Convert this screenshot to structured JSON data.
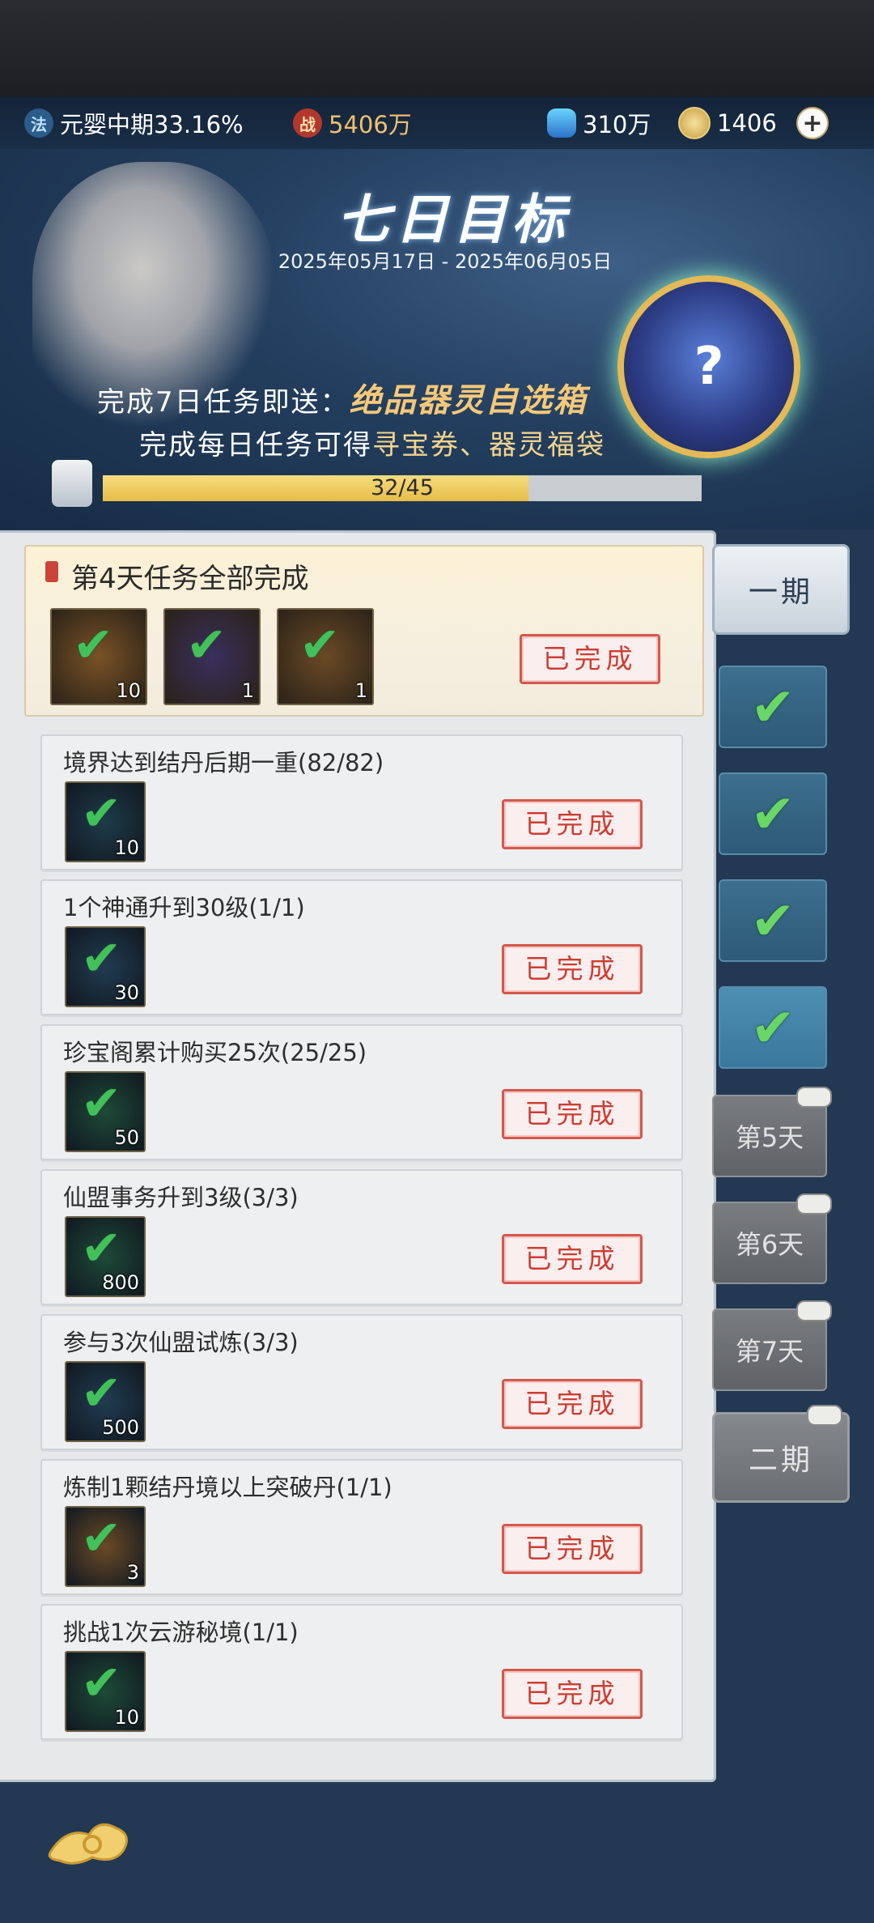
{
  "resources": {
    "realm": {
      "icon": "dao-icon",
      "label": "元婴中期33.16%"
    },
    "power": {
      "icon": "battle-icon",
      "label": "5406万"
    },
    "spirit_stone": {
      "icon": "crystal-icon",
      "label": "310万"
    },
    "jade": {
      "icon": "jade-coin-icon",
      "label": "1406"
    }
  },
  "event": {
    "title": "七日目标",
    "dates": "2025年05月17日 - 2025年06月05日",
    "line1_prefix": "完成7日任务即送：",
    "line1_highlight": "绝品器灵自选箱",
    "line2_prefix": "完成每日任务可得",
    "line2_highlight": "寻宝券、器灵福袋",
    "progress_text": "32/45",
    "progress_fraction": 0.711,
    "mystery_reward_icon": "question-mark-icon"
  },
  "day_summary": {
    "title": "第4天任务全部完成",
    "items": [
      {
        "icon": "talisman-item-icon",
        "count": "10",
        "bg": "#7a5226"
      },
      {
        "icon": "spirit-orb-item-icon",
        "count": "1",
        "bg": "#3a2f5e"
      },
      {
        "icon": "treasure-box-item-icon",
        "count": "1",
        "bg": "#6b4a26"
      }
    ],
    "status": "已完成"
  },
  "tasks": [
    {
      "title": "境界达到结丹后期一重(82/82)",
      "icon": "scroll-item-icon",
      "count": "10",
      "bg": "#1f3b4a",
      "status": "已完成"
    },
    {
      "title": "1个神通升到30级(1/1)",
      "icon": "pouch-item-icon",
      "count": "30",
      "bg": "#223c52",
      "status": "已完成"
    },
    {
      "title": "珍宝阁累计购买25次(25/25)",
      "icon": "chest-item-icon",
      "count": "50",
      "bg": "#1e4a38",
      "status": "已完成"
    },
    {
      "title": "仙盟事务升到3级(3/3)",
      "icon": "bundle-item-icon",
      "count": "800",
      "bg": "#1e4a38",
      "status": "已完成"
    },
    {
      "title": "参与3次仙盟试炼(3/3)",
      "icon": "book-item-icon",
      "count": "500",
      "bg": "#223c52",
      "status": "已完成"
    },
    {
      "title": "炼制1颗结丹境以上突破丹(1/1)",
      "icon": "crystal-item-icon",
      "count": "3",
      "bg": "#6b4a26",
      "status": "已完成"
    },
    {
      "title": "挑战1次云游秘境(1/1)",
      "icon": "jade-item-icon",
      "count": "10",
      "bg": "#1e4a38",
      "status": "已完成"
    }
  ],
  "side_tabs": {
    "period1": "一期",
    "completed_days": [
      "check-icon",
      "check-icon",
      "check-icon",
      "check-icon"
    ],
    "locked_days": [
      "第5天",
      "第6天",
      "第7天"
    ],
    "period2": "二期"
  }
}
